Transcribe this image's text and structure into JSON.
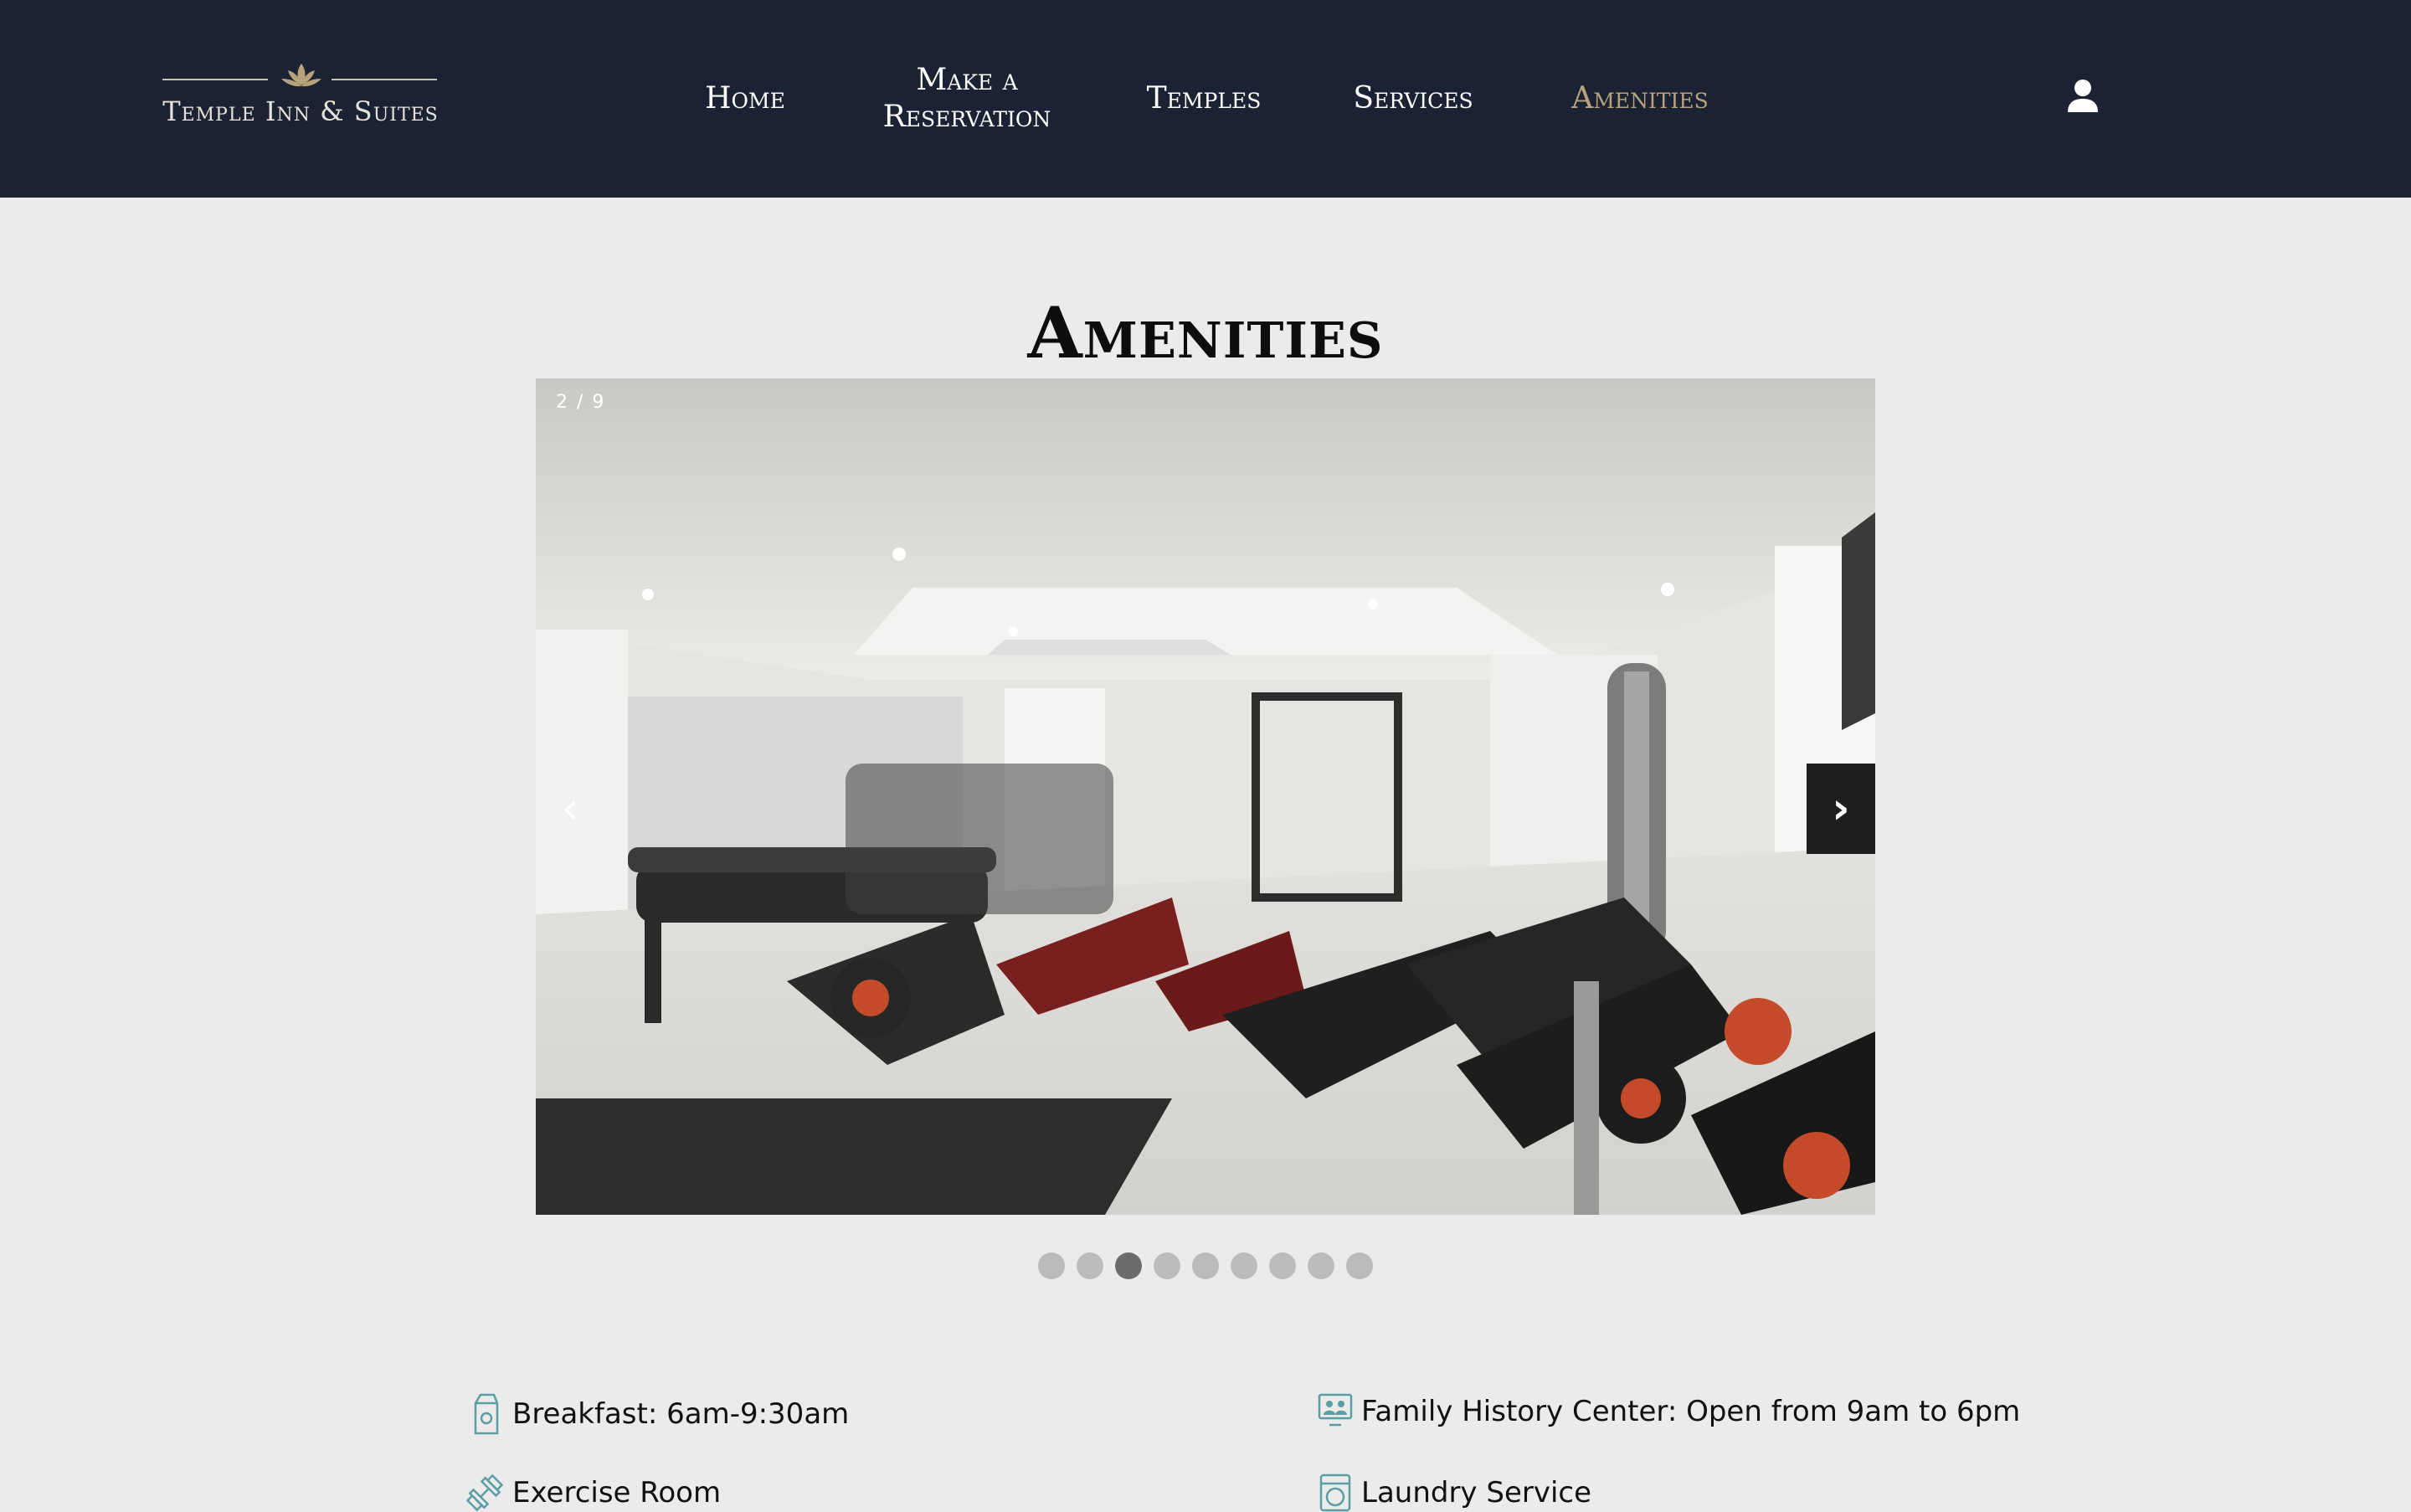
{
  "brand": {
    "name": "Temple Inn & Suites"
  },
  "nav": {
    "items": [
      {
        "label": "Home"
      },
      {
        "label": "Make a Reservation"
      },
      {
        "label": "Temples"
      },
      {
        "label": "Services"
      },
      {
        "label": "Amenities"
      }
    ],
    "active": "Amenities"
  },
  "page": {
    "title": "Amenities"
  },
  "carousel": {
    "counter": "2 / 9",
    "prev_label": "‹",
    "next_label": "›",
    "total_slides": 9,
    "active_dot": 3
  },
  "amenities": [
    {
      "label": "Breakfast: 6am-9:30am",
      "icon": "milk-carton-icon"
    },
    {
      "label": "Family History Center: Open from 9am to 6pm",
      "icon": "computer-users-icon"
    },
    {
      "label": "Exercise Room",
      "icon": "dumbbell-icon"
    },
    {
      "label": "Laundry Service",
      "icon": "washing-machine-icon"
    }
  ],
  "colors": {
    "header_bg": "#1b2234",
    "accent_gold": "#b8a27a",
    "page_bg": "#ebebeb",
    "icon_teal": "#5b9ea3"
  }
}
